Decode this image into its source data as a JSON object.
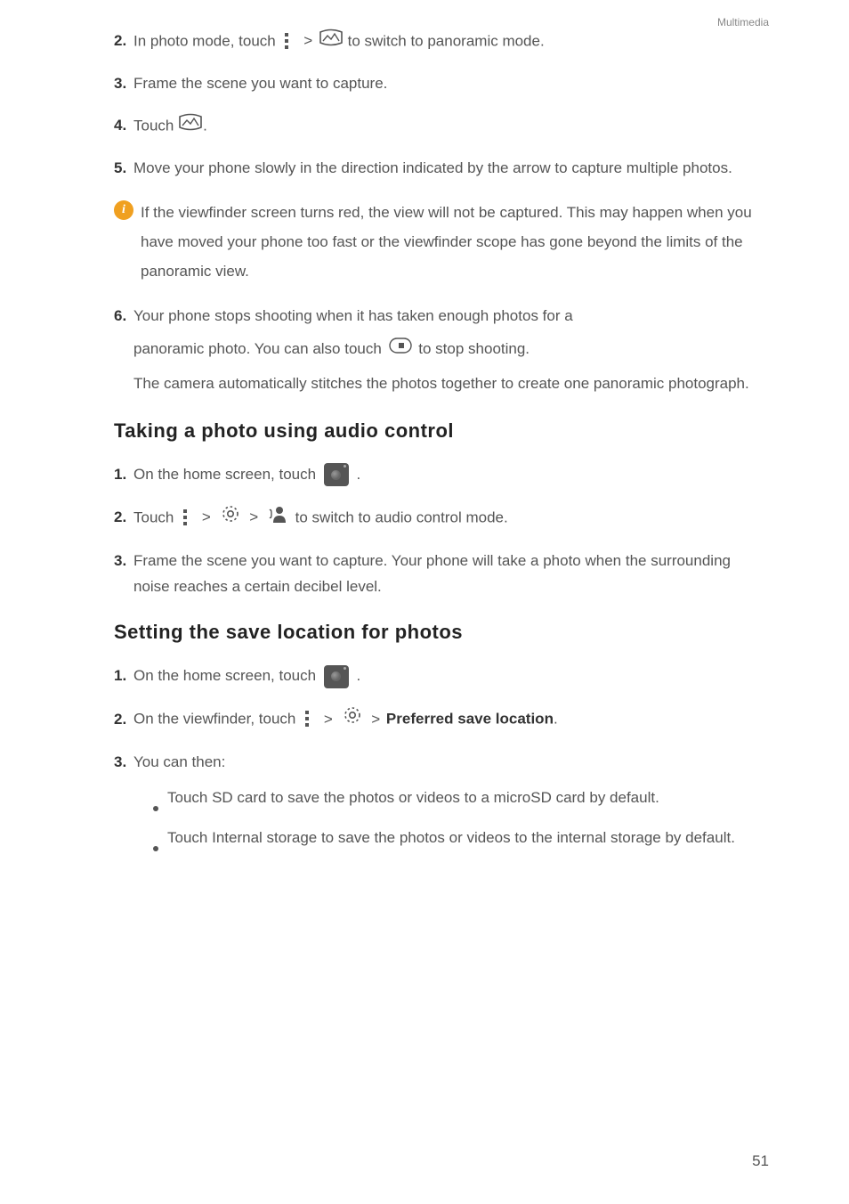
{
  "header": {
    "section_label": "Multimedia"
  },
  "steps_a": {
    "s2": {
      "num": "2.",
      "t1": "In photo mode, touch ",
      "t2": "to switch to panoramic mode."
    },
    "s3": {
      "num": "3.",
      "t1": "Frame the scene you want to capture."
    },
    "s4": {
      "num": "4.",
      "t1": "Touch ",
      "t2": "."
    },
    "s5": {
      "num": "5.",
      "t1": "Move your phone slowly in the direction indicated by the arrow to capture multiple photos."
    },
    "info": "If the viewfinder screen turns red, the view will not be captured. This may happen when you have moved your phone too fast or the viewfinder scope has gone beyond the limits of the panoramic view.",
    "s6": {
      "num": "6.",
      "line1a": "Your phone stops shooting when it has taken enough photos for a",
      "line2a": "panoramic photo. You can also touch ",
      "line2b": "to stop shooting.",
      "line3": "The camera automatically stitches the photos together to create one panoramic photograph."
    }
  },
  "heading_b": "Taking a photo using audio control",
  "steps_b": {
    "s1": {
      "num": "1.",
      "t1": "On the home screen, touch ",
      "t2": "."
    },
    "s2": {
      "num": "2.",
      "t1": "Touch ",
      "t2": " to switch to audio control mode."
    },
    "s3": {
      "num": "3.",
      "t1": "Frame the scene you want to capture. Your phone will take a photo when the surrounding noise reaches a certain decibel level."
    }
  },
  "heading_c": "Setting the save location for photos",
  "steps_c": {
    "s1": {
      "num": "1.",
      "t1": "On the home screen, touch ",
      "t2": "."
    },
    "s2": {
      "num": "2.",
      "t1": "On the viewfinder, touch ",
      "bold": "Preferred save location",
      "t2": "."
    },
    "s3": {
      "num": "3.",
      "t1": "You can then:"
    },
    "bullets": {
      "b1": {
        "t1": "Touch ",
        "bold": "SD card",
        "t2": " to save the photos or videos to a microSD card by default."
      },
      "b2": {
        "t1": "Touch ",
        "bold": "Internal storage",
        "t2": " to save the photos or videos to the internal storage by default."
      }
    }
  },
  "page_number": "51"
}
